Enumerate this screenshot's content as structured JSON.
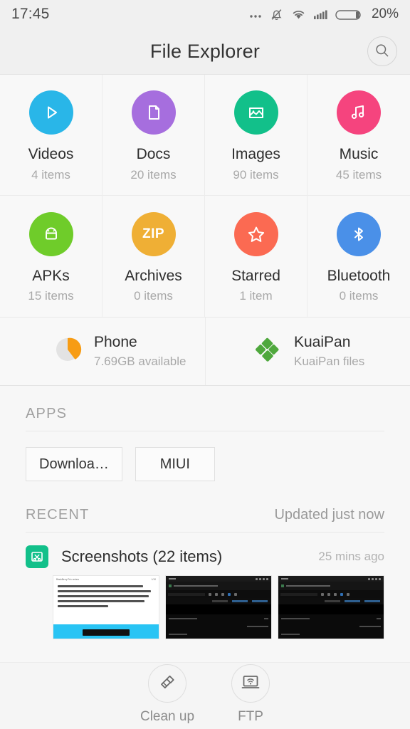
{
  "status_bar": {
    "time": "17:45",
    "battery_percent": "20%",
    "icons": [
      "more-dots-icon",
      "bell-muted-icon",
      "wifi-icon",
      "signal-bars-icon",
      "battery-icon"
    ]
  },
  "header": {
    "title": "File Explorer",
    "search_icon": "search-icon"
  },
  "categories": [
    {
      "label": "Videos",
      "count": "4 items",
      "color": "#29b6e8",
      "icon": "play-icon"
    },
    {
      "label": "Docs",
      "count": "20 items",
      "color": "#a濃",
      "icon": "document-icon"
    },
    {
      "label": "Images",
      "count": "90 items",
      "color": "#12c08a",
      "icon": "image-icon"
    },
    {
      "label": "Music",
      "count": "45 items",
      "color": "#f5447e",
      "icon": "music-note-icon"
    },
    {
      "label": "APKs",
      "count": "15 items",
      "color": "#6fcc2a",
      "icon": "android-icon"
    },
    {
      "label": "Archives",
      "count": "0 items",
      "color": "#efaf35",
      "icon": "zip-icon",
      "icon_text": "ZIP"
    },
    {
      "label": "Starred",
      "count": "1 item",
      "color": "#fb6a52",
      "icon": "star-icon"
    },
    {
      "label": "Bluetooth",
      "count": "0 items",
      "color": "#4a90e8",
      "icon": "bluetooth-icon"
    }
  ],
  "storage": [
    {
      "name": "Phone",
      "sub": "7.69GB available",
      "icon": "pie-chart-icon"
    },
    {
      "name": "KuaiPan",
      "sub": "KuaiPan files",
      "icon": "kuaipan-logo-icon"
    }
  ],
  "apps_section": {
    "title": "APPS",
    "chips": [
      {
        "label": "Downloa…"
      },
      {
        "label": "MIUI"
      }
    ]
  },
  "recent_section": {
    "title": "RECENT",
    "updated": "Updated just now",
    "item": {
      "name": "Screenshots (22 items)",
      "time": "25 mins ago",
      "folder_icon": "screenshot-folder-icon"
    },
    "thumbnails": [
      {
        "type": "article-screenshot",
        "header_title": "BlackBerry Priv review",
        "header_meta": "1/10",
        "lines": [
          "down as a visionary, not an",
          "anomaly. Before we start exploring",
          "it though, we simply feel compelled",
          "to stop and let its marvelous am",
          "bivalence sink in."
        ]
      },
      {
        "type": "dark-screenshot",
        "header_title": "BlackBerry Priv review: Privilege pearl",
        "status_time": "10:18",
        "battery": "42%"
      },
      {
        "type": "dark-screenshot",
        "header_title": "BlackBerry Priv review: Privilege pearl",
        "status_time": "10:18",
        "battery": "42%"
      }
    ]
  },
  "bottom_bar": [
    {
      "label": "Clean up",
      "icon": "broom-icon"
    },
    {
      "label": "FTP",
      "icon": "ftp-screen-wifi-icon"
    }
  ]
}
